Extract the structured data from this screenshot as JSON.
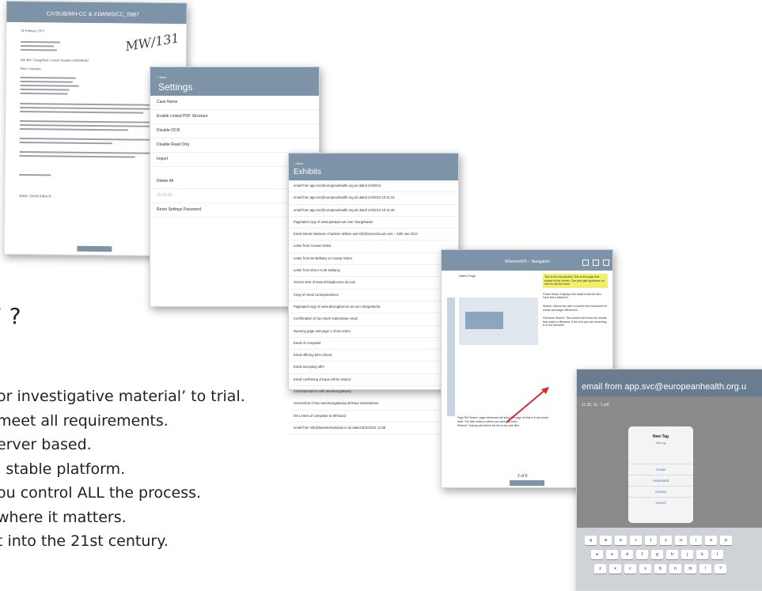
{
  "slide": {
    "heading": "’ ?",
    "bullets": [
      "or investigative material’ to trial.",
      "meet all requirements.",
      "erver based.",
      "l stable platform.",
      "ou control ALL the process.",
      "where it matters.",
      "t into the 21st century."
    ]
  },
  "document": {
    "title": "CX/SUB/MH-CC & #1M/MS/CC_0987",
    "date": "24 February 2013",
    "signature": "MW/131",
    "sender": "WMS: CHARGEBACK",
    "ref_line": "Our Ref: Chargeback Control Number 2005040302",
    "greeting": "Dear Customer,",
    "page_indicator": ""
  },
  "settings": {
    "back": "< Back",
    "title": "Settings",
    "items": [
      "Case Name",
      "Enable Linked PDF Structure",
      "Disable OCR",
      "Disable Read Only",
      "Import",
      "Delete All",
      "10.01.03",
      "Reset Settings Password"
    ]
  },
  "exhibits": {
    "back": "< Back",
    "title": "Exhibits",
    "items": [
      "email from app.svc@europeanhealth.org.uk dated 2/4/2013",
      "email from app.svc@europeanhealth.org.uk dated 2/4/2013 10:11:44",
      "email from app.svc@europeanhealth.org.uk dated 2/4/2013 10:11:45",
      "Paginated copy of www.passport.uk.com chargebacks",
      "Email stream between Charlene Wilson and info@eurocrisa.uk.com – 16th Jan 2013",
      "Letter from Caveat Visitor",
      "Letter from Mr Bellamy to Caveat Visitor",
      "Letter from DVLA to Mr Bellamy",
      "Screen shot of www.drivinglicence.uk.com",
      "Copy of email correspondence",
      "Paginated copy of www.drivinglicence.uk.com chargebacks",
      "Confirmation of tax return submission email",
      "Opening page and page 1 of tax return",
      "Email of complaint",
      "Email offering 50% refund",
      "Email accepting offer",
      "Email confirming cheque will be issued",
      "Correspondence with taxreturngateway",
      "Screenshot of two taxreturngateway 50/Hour submissions",
      "DS Letters of complaint to Whs4Ltd",
      "email from info@taxreturnsahead.co.uk dated 5/01/2014 12:59"
    ]
  },
  "viewer": {
    "title": "WhereveWS – Navigation",
    "page_label": "Name Page",
    "notes_highlight": "This is the Introduction This is the page first shown to the viewer. Can also give guidance on how to use the case.",
    "notes": [
      "Folder Mode: Displays the folders that the files have been placed in.",
      "Search: Allows the user to search the document for words and page references.",
      "Filename Search: This search will show the results that match a filename, if the text you are searching is in the filename.",
      "Page Ref Search: page references will show the page ref that is in document.",
      "Note: The help button is where you have just been.",
      "Refresh: Clicking will refresh the list of any new files."
    ],
    "page_number": "2 of 6"
  },
  "tag": {
    "nav_title": "email from app.svc@europeanhealth.org.u",
    "subhead": "11:35, Sc, 1.pdf",
    "dialog_title": "New Tag",
    "dialog_input": "Add tag",
    "buttons": [
      "Create",
      "Associated",
      "Unread",
      "Cancel"
    ],
    "keyboard_rows": [
      [
        "q",
        "w",
        "e",
        "r",
        "t",
        "y",
        "u",
        "i",
        "o",
        "p"
      ],
      [
        "a",
        "s",
        "d",
        "f",
        "g",
        "h",
        "j",
        "k",
        "l"
      ],
      [
        "z",
        "x",
        "c",
        "v",
        "b",
        "n",
        "m",
        "!",
        "?"
      ]
    ]
  },
  "colors": {
    "navbar": "#7d93a8",
    "highlight": "#f1f06b",
    "circle": "#2159d8",
    "arrow": "#d82a2a"
  }
}
